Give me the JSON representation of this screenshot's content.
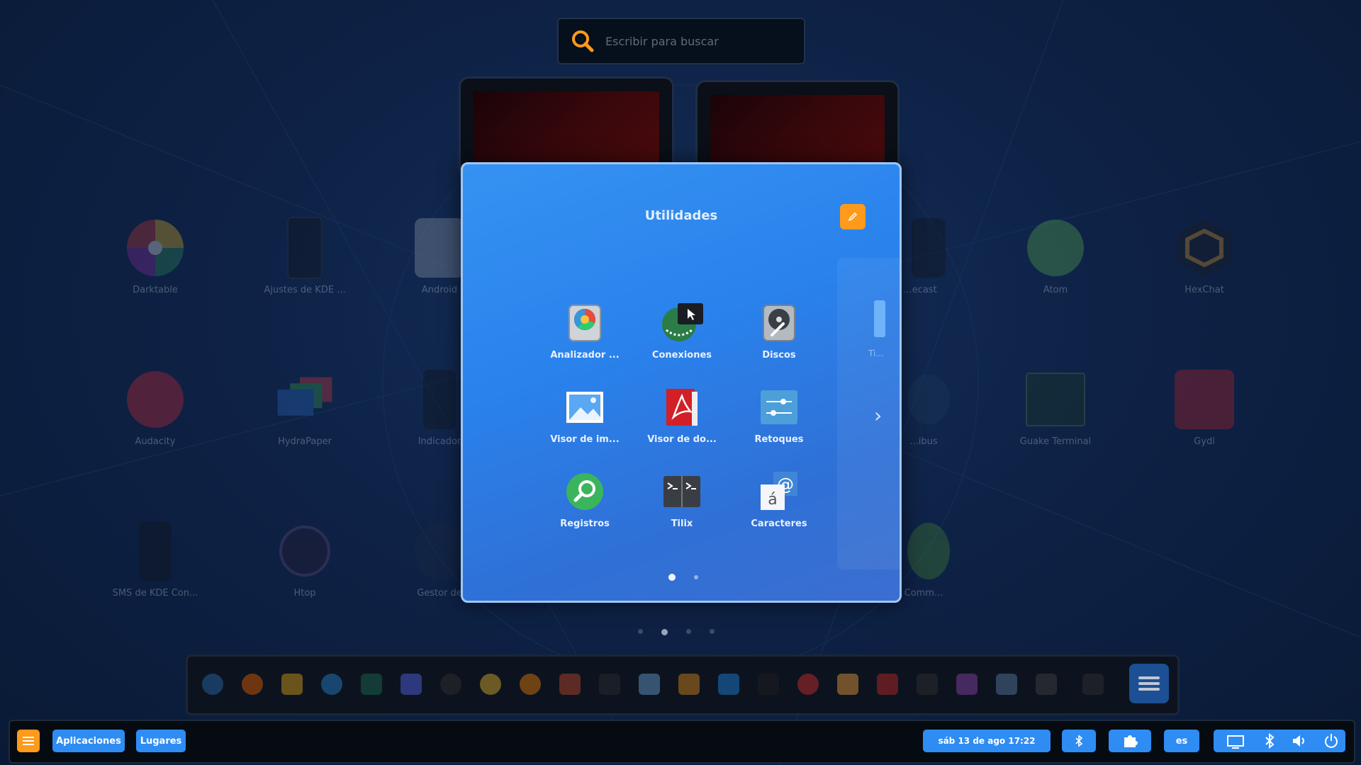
{
  "search": {
    "placeholder": "Escribir para buscar"
  },
  "background_apps": [
    {
      "label": "Darktable",
      "icon": "darktable-icon"
    },
    {
      "label": "Ajustes de KDE ...",
      "icon": "kdeconnect-icon"
    },
    {
      "label": "Android",
      "icon": "android-icon"
    },
    {
      "label": "...ecast",
      "icon": "peek-icon"
    },
    {
      "label": "Atom",
      "icon": "atom-icon"
    },
    {
      "label": "HexChat",
      "icon": "hexchat-icon"
    },
    {
      "label": "Audacity",
      "icon": "audacity-icon"
    },
    {
      "label": "HydraPaper",
      "icon": "hydrapaper-icon"
    },
    {
      "label": "Indicador",
      "icon": "kdeconnect-indicator-icon"
    },
    {
      "label": "...ibus",
      "icon": "ibus-icon"
    },
    {
      "label": "Guake Terminal",
      "icon": "guake-icon"
    },
    {
      "label": "Gydl",
      "icon": "gydl-icon"
    },
    {
      "label": "SMS de KDE Con...",
      "icon": "kdeconnect-sms-icon"
    },
    {
      "label": "Htop",
      "icon": "htop-icon"
    },
    {
      "label": "Gestor de",
      "icon": "bluetooth-manager-icon"
    },
    {
      "label": "Comm...",
      "icon": "cc-icon"
    }
  ],
  "folder": {
    "title": "Utilidades",
    "apps": [
      {
        "label": "Analizador ...",
        "icon": "disk-usage-analyzer-icon"
      },
      {
        "label": "Conexiones",
        "icon": "connections-icon"
      },
      {
        "label": "Discos",
        "icon": "disks-icon"
      },
      {
        "label": "Visor de im...",
        "icon": "image-viewer-icon"
      },
      {
        "label": "Visor de do...",
        "icon": "document-viewer-icon"
      },
      {
        "label": "Retoques",
        "icon": "tweaks-icon"
      },
      {
        "label": "Registros",
        "icon": "logs-icon"
      },
      {
        "label": "Tilix",
        "icon": "tilix-icon"
      },
      {
        "label": "Caracteres",
        "icon": "characters-icon"
      }
    ],
    "peek_label": "Ti..."
  },
  "panel": {
    "apps_label": "Aplicaciones",
    "places_label": "Lugares",
    "datetime": "sáb 13 de ago  17:22",
    "language": "es"
  },
  "colors": {
    "accent": "#2f8cf3",
    "orange": "#ff9a1a",
    "folder_bg": "#2a82ec"
  }
}
